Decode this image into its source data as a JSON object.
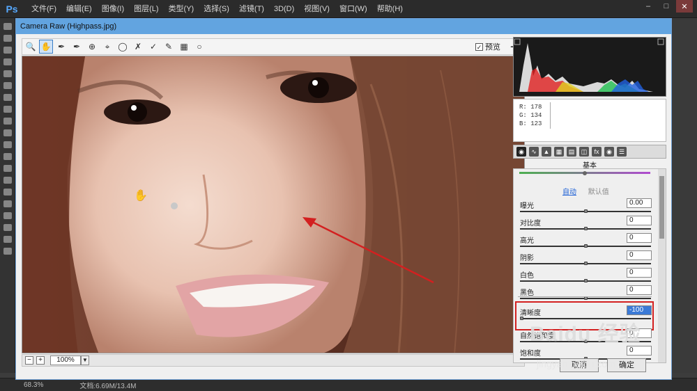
{
  "app": {
    "logo": "Ps",
    "menu": [
      "文件(F)",
      "编辑(E)",
      "图像(I)",
      "图层(L)",
      "类型(Y)",
      "选择(S)",
      "滤镜(T)",
      "3D(D)",
      "视图(V)",
      "窗口(W)",
      "帮助(H)"
    ],
    "window_controls": [
      "–",
      "□",
      "✕"
    ]
  },
  "status": {
    "zoom": "68.3%",
    "doc": "文档:6.69M/13.4M"
  },
  "dialog": {
    "title": "Camera Raw (Highpass.jpg)",
    "preview_label": "预览",
    "preview_checked": true,
    "zoom_value": "100%",
    "zoom_minus": "−",
    "zoom_plus": "+",
    "tools": [
      "zoom-icon",
      "hand-icon",
      "white-balance-icon",
      "color-sampler-icon",
      "targeted-adjust-icon",
      "crop-icon",
      "straighten-icon",
      "spot-removal-icon",
      "red-eye-icon",
      "adjustment-brush-icon",
      "graduated-filter-icon",
      "radial-filter-icon"
    ],
    "buttons": {
      "cancel": "取消",
      "ok": "确定"
    }
  },
  "readout": {
    "r_label": "R:",
    "r": "178",
    "g_label": "G:",
    "g": "134",
    "b_label": "B:",
    "b": "123"
  },
  "panel": {
    "title": "基本",
    "auto": "自动",
    "default": "默认值",
    "sliders": [
      {
        "label": "曝光",
        "value": "0.00",
        "pos": 0.5
      },
      {
        "label": "对比度",
        "value": "0",
        "pos": 0.5
      },
      {
        "label": "高光",
        "value": "0",
        "pos": 0.5
      },
      {
        "label": "阴影",
        "value": "0",
        "pos": 0.5
      },
      {
        "label": "白色",
        "value": "0",
        "pos": 0.5
      },
      {
        "label": "黑色",
        "value": "0",
        "pos": 0.5
      },
      {
        "label": "清晰度",
        "value": "-100",
        "pos": 0.0
      },
      {
        "label": "自然饱和度",
        "value": "0",
        "pos": 0.5
      },
      {
        "label": "饱和度",
        "value": "0",
        "pos": 0.5
      }
    ]
  },
  "watermark": {
    "brand": "Baidu 经验",
    "url": "jingyan.baidu.com"
  },
  "colors": {
    "dialog_title_bar": "#62a4e0",
    "highlight_box": "#d32020",
    "arrow": "#d32020",
    "link": "#1b5fd6"
  }
}
